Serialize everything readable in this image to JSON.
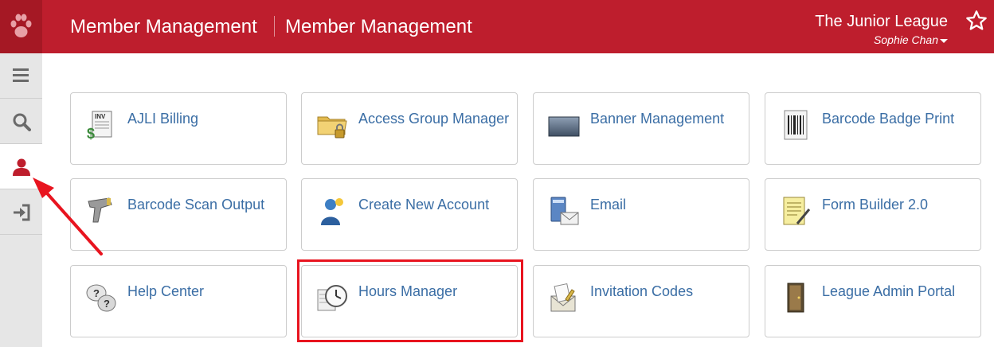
{
  "header": {
    "title_primary": "Member Management",
    "title_secondary": "Member Management",
    "organization": "The Junior League",
    "user_name": "Sophie Chan",
    "brand_color": "#be1e2d"
  },
  "sidebar": {
    "items": [
      {
        "icon": "menu-icon"
      },
      {
        "icon": "search-icon"
      },
      {
        "icon": "user-icon",
        "active": true
      },
      {
        "icon": "sign-in-icon"
      }
    ]
  },
  "tiles": [
    {
      "label": "AJLI Billing",
      "icon": "invoice-icon"
    },
    {
      "label": "Access Group Manager",
      "icon": "folder-lock-icon"
    },
    {
      "label": "Banner Management",
      "icon": "banner-icon"
    },
    {
      "label": "Barcode Badge Print",
      "icon": "barcode-icon"
    },
    {
      "label": "Barcode Scan Output",
      "icon": "barcode-scanner-icon"
    },
    {
      "label": "Create New Account",
      "icon": "new-user-icon"
    },
    {
      "label": "Email",
      "icon": "email-icon"
    },
    {
      "label": "Form Builder 2.0",
      "icon": "form-icon"
    },
    {
      "label": "Help Center",
      "icon": "help-bubbles-icon"
    },
    {
      "label": "Hours Manager",
      "icon": "clock-notebook-icon",
      "highlighted": true
    },
    {
      "label": "Invitation Codes",
      "icon": "invitation-icon"
    },
    {
      "label": "League Admin Portal",
      "icon": "door-icon"
    }
  ],
  "annotation_color": "#e8141f"
}
